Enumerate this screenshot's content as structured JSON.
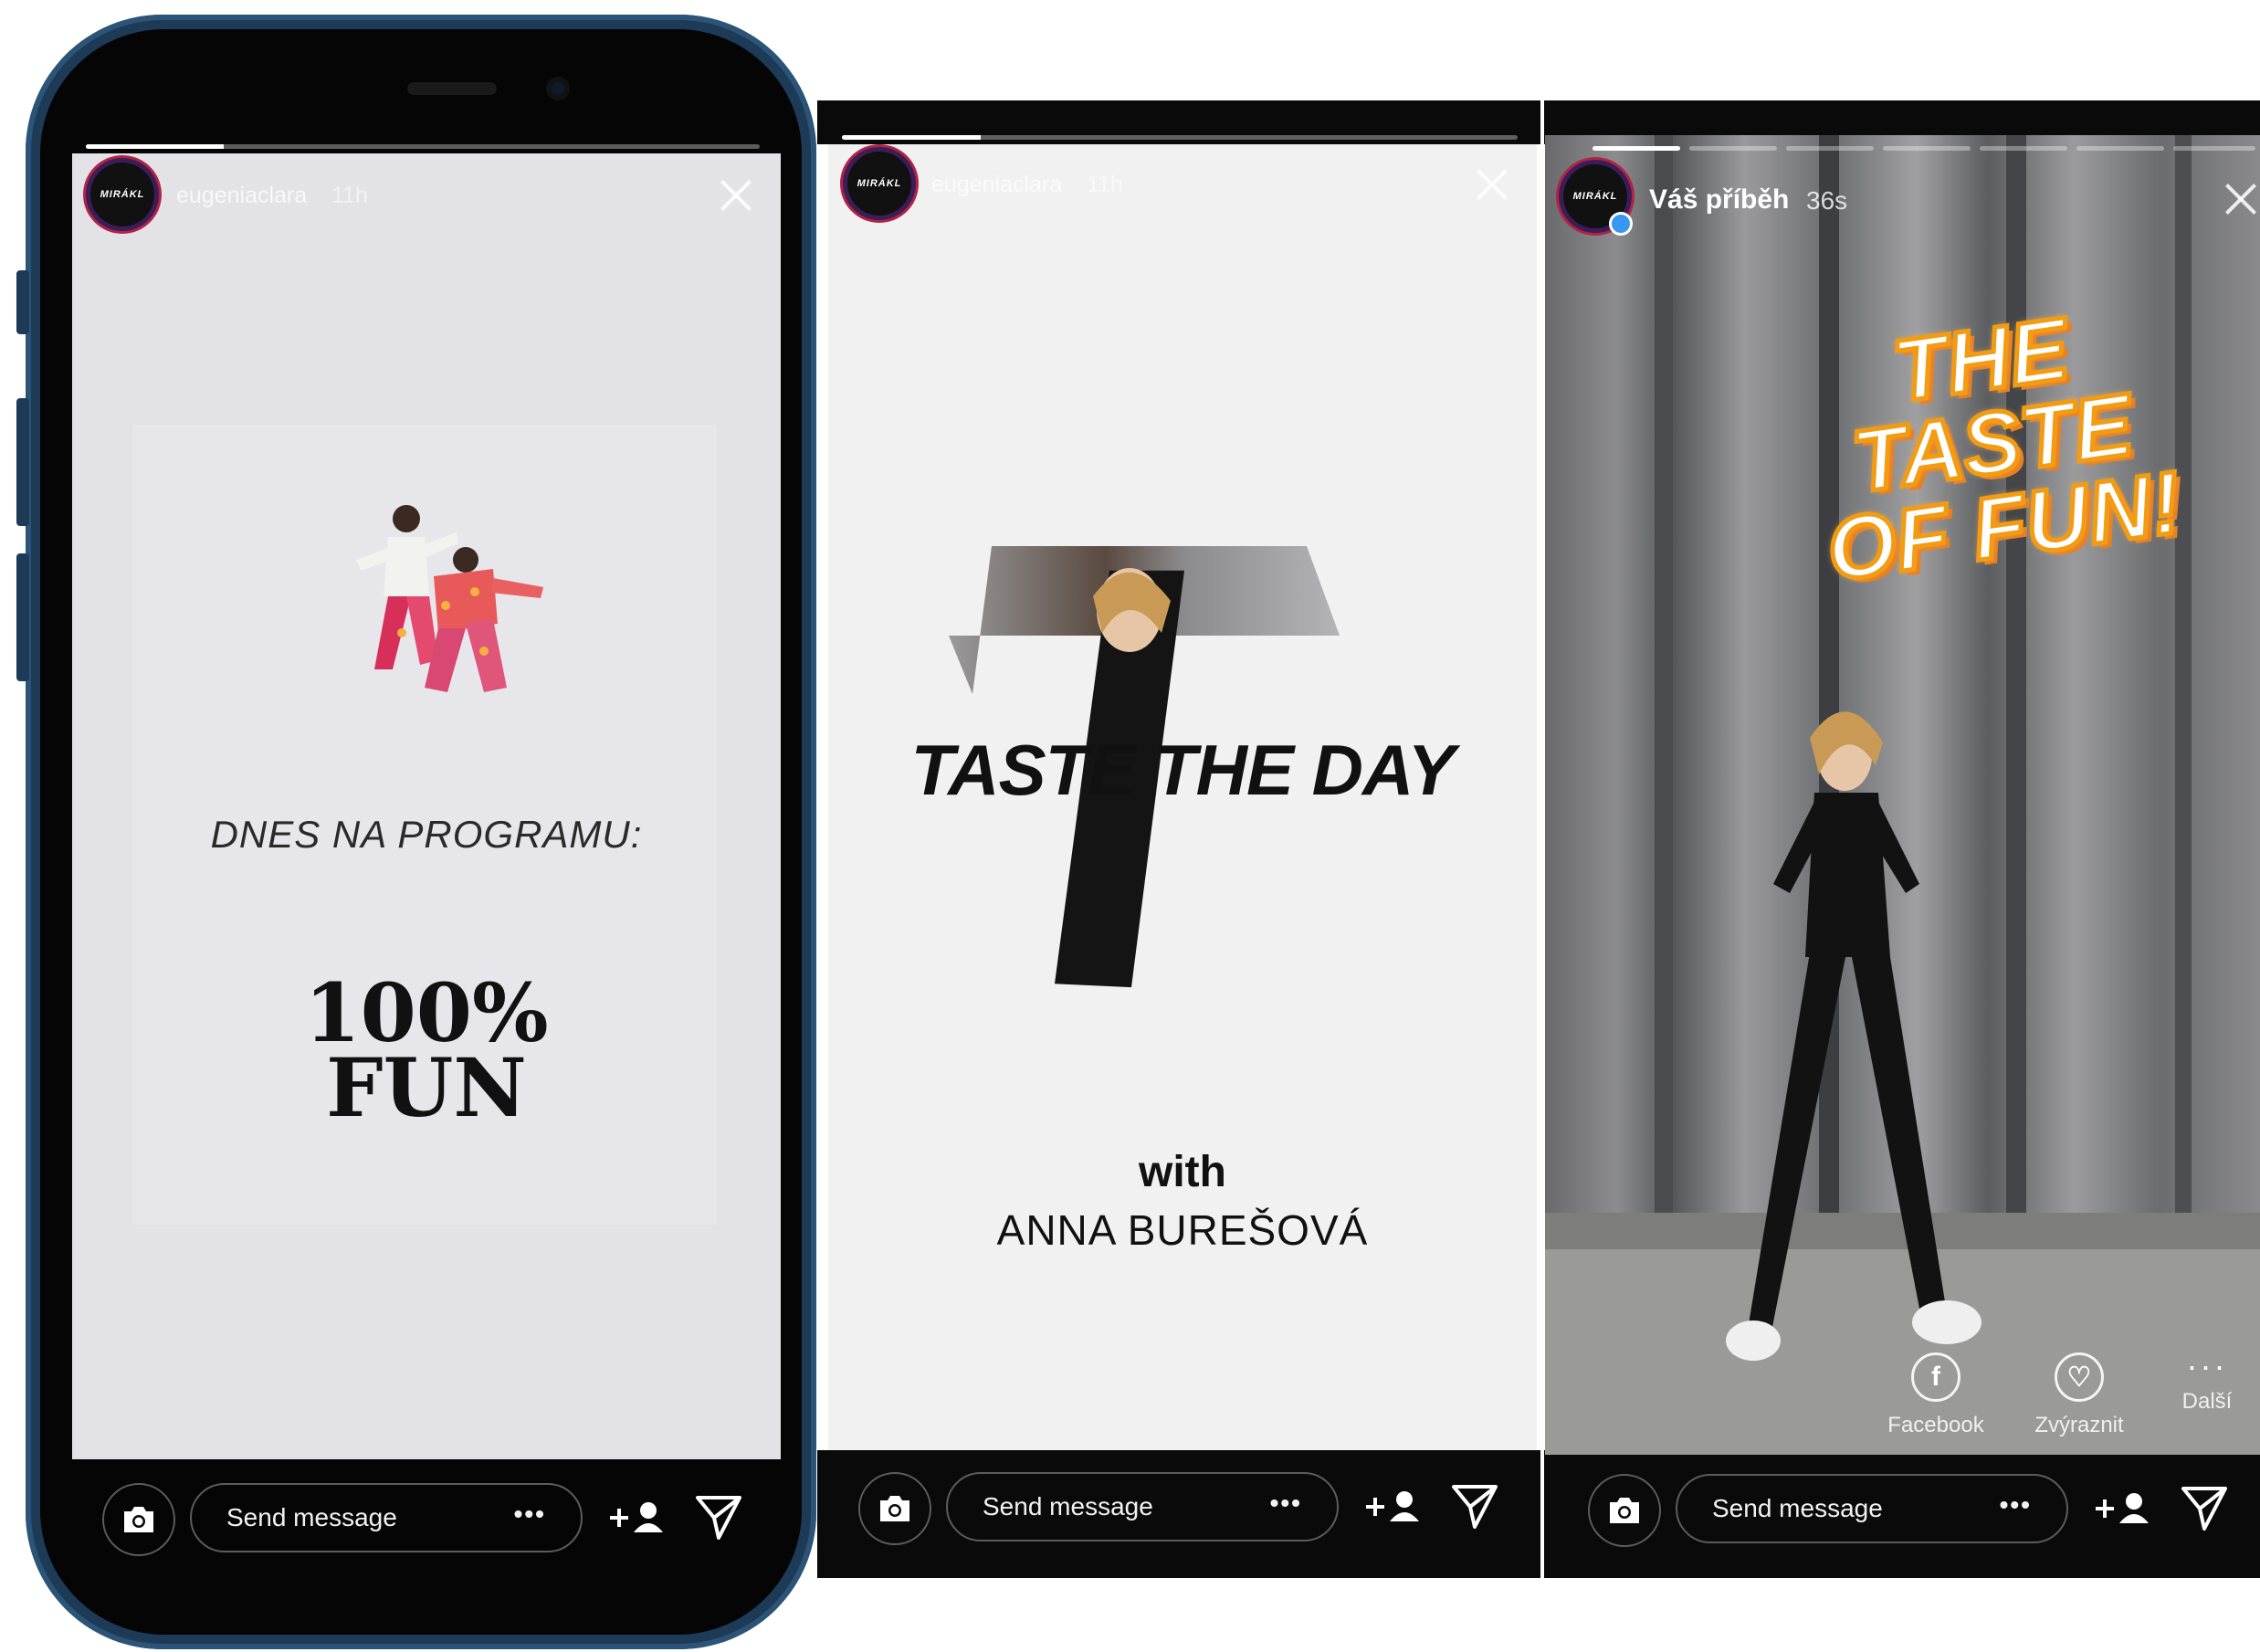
{
  "stories": [
    {
      "username": "eugeniaclara",
      "time": "11h",
      "avatar_text": "MIRÁKL",
      "headline": "DNES NA PROGRAMU:",
      "fun_line1": "100%",
      "fun_line2": "FUN"
    },
    {
      "username": "eugeniaclara",
      "time": "11h",
      "avatar_text": "MIRÁKL",
      "title": "TASTE THE DAY",
      "with": "with",
      "guest": "ANNA BUREŠOVÁ"
    },
    {
      "username": "Váš příběh",
      "time": "36s",
      "avatar_text": "MIRÁKL",
      "sticker_line1": "THE TASTE",
      "sticker_line2": "OF FUN!",
      "actions": [
        {
          "label": "Facebook",
          "icon": "facebook-icon"
        },
        {
          "label": "Zvýraznit",
          "icon": "highlight-icon"
        },
        {
          "label": "Další",
          "icon": "more-icon"
        }
      ]
    }
  ],
  "bottom_bar": {
    "placeholder": "Send message",
    "more": "•••"
  },
  "colors": {
    "accent_ring": "#b02344",
    "phone_frame": "#1d3a57",
    "sticker_orange": "#f39c12"
  }
}
